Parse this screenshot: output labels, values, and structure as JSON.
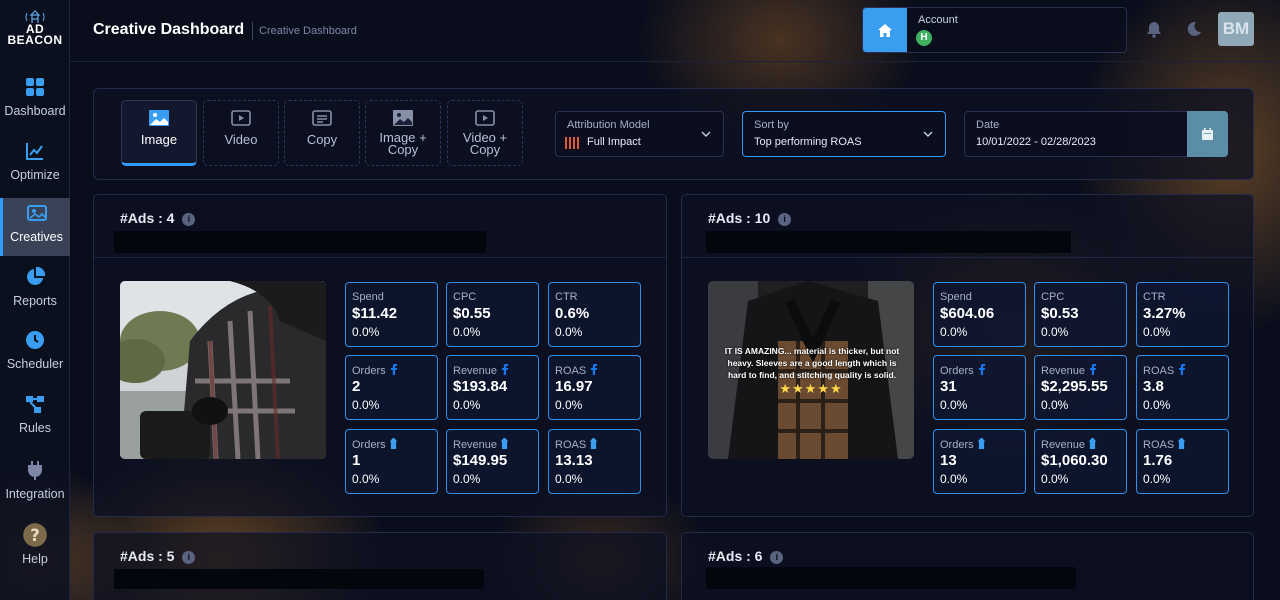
{
  "app": {
    "logo_top": "AD",
    "logo_bottom": "BEACON"
  },
  "sidebar": {
    "items": [
      {
        "label": "Dashboard",
        "icon": "grid-icon"
      },
      {
        "label": "Optimize",
        "icon": "chart-line-icon"
      },
      {
        "label": "Creatives",
        "icon": "image-icon",
        "active": true
      },
      {
        "label": "Reports",
        "icon": "pie-chart-icon"
      },
      {
        "label": "Scheduler",
        "icon": "clock-icon"
      },
      {
        "label": "Rules",
        "icon": "flow-icon"
      },
      {
        "label": "Integration",
        "icon": "plug-icon"
      },
      {
        "label": "Help",
        "icon": "help-icon"
      }
    ]
  },
  "header": {
    "title": "Creative Dashboard",
    "breadcrumb": "Creative Dashboard",
    "account_label": "Account",
    "account_badge": "H",
    "avatar": "BM"
  },
  "filters": {
    "tabs": [
      {
        "label": "Image",
        "active": true
      },
      {
        "label": "Video"
      },
      {
        "label": "Copy"
      },
      {
        "label": "Image +\nCopy"
      },
      {
        "label": "Video +\nCopy"
      }
    ],
    "attribution": {
      "label": "Attribution Model",
      "value": "Full Impact"
    },
    "sort": {
      "label": "Sort by",
      "value": "Top performing ROAS"
    },
    "date": {
      "label": "Date",
      "value": "10/01/2022 - 02/28/2023"
    }
  },
  "cards": [
    {
      "title": "#Ads : 4",
      "metrics": [
        {
          "label": "Spend",
          "value": "$11.42",
          "change": "0.0%"
        },
        {
          "label": "CPC",
          "value": "$0.55",
          "change": "0.0%"
        },
        {
          "label": "CTR",
          "value": "0.6%",
          "change": "0.0%"
        },
        {
          "label": "Orders",
          "value": "2",
          "change": "0.0%",
          "icon": "facebook-icon"
        },
        {
          "label": "Revenue",
          "value": "$193.84",
          "change": "0.0%",
          "icon": "facebook-icon"
        },
        {
          "label": "ROAS",
          "value": "16.97",
          "change": "0.0%",
          "icon": "facebook-icon"
        },
        {
          "label": "Orders",
          "value": "1",
          "change": "0.0%",
          "icon": "beacon-icon"
        },
        {
          "label": "Revenue",
          "value": "$149.95",
          "change": "0.0%",
          "icon": "beacon-icon"
        },
        {
          "label": "ROAS",
          "value": "13.13",
          "change": "0.0%",
          "icon": "beacon-icon"
        }
      ]
    },
    {
      "title": "#Ads : 10",
      "ad_text": "IT IS AMAZING... material is thicker, but not heavy. Sleeves are a good length which is hard to find, and stitching quality is solid.",
      "ad_stars": "★★★★★",
      "metrics": [
        {
          "label": "Spend",
          "value": "$604.06",
          "change": "0.0%"
        },
        {
          "label": "CPC",
          "value": "$0.53",
          "change": "0.0%"
        },
        {
          "label": "CTR",
          "value": "3.27%",
          "change": "0.0%"
        },
        {
          "label": "Orders",
          "value": "31",
          "change": "0.0%",
          "icon": "facebook-icon"
        },
        {
          "label": "Revenue",
          "value": "$2,295.55",
          "change": "0.0%",
          "icon": "facebook-icon"
        },
        {
          "label": "ROAS",
          "value": "3.8",
          "change": "0.0%",
          "icon": "facebook-icon"
        },
        {
          "label": "Orders",
          "value": "13",
          "change": "0.0%",
          "icon": "beacon-icon"
        },
        {
          "label": "Revenue",
          "value": "$1,060.30",
          "change": "0.0%",
          "icon": "beacon-icon"
        },
        {
          "label": "ROAS",
          "value": "1.76",
          "change": "0.0%",
          "icon": "beacon-icon"
        }
      ]
    },
    {
      "title": "#Ads : 5"
    },
    {
      "title": "#Ads : 6"
    }
  ],
  "colors": {
    "accent": "#2f9bff",
    "facebook": "#1877f2",
    "beacon": "#3a9ef0"
  }
}
